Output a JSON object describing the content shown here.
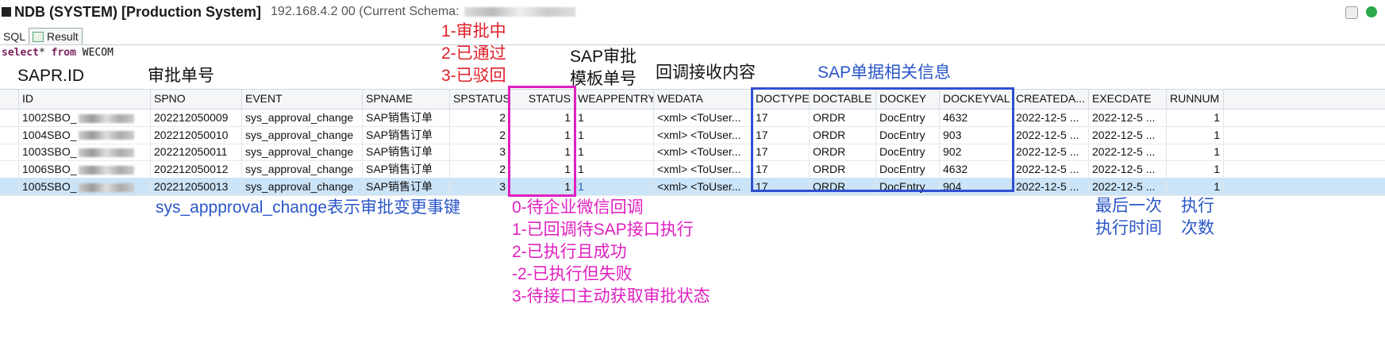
{
  "window": {
    "title": "NDB (SYSTEM) [Production System]",
    "subtitle": "192.168.4.2 00 (Current Schema: "
  },
  "tabs": [
    {
      "label": "SQL"
    },
    {
      "label": "Result"
    }
  ],
  "sql": {
    "kw1": "select",
    "star": "*",
    "kw2": "from",
    "table": "WECOM"
  },
  "annotations": {
    "status_legend": [
      "1-审批中",
      "2-已通过",
      "3-已驳回"
    ],
    "sapr_id": "SAPR.ID",
    "spno": "审批单号",
    "template": [
      "SAP审批",
      "模板单号"
    ],
    "callback": "回调接收内容",
    "sap_info": "SAP单据相关信息",
    "event_note": "sys_appproval_change表示审批变更事键",
    "status_codes": [
      "0-待企业微信回调",
      "1-已回调待SAP接口执行",
      "2-已执行且成功",
      "-2-已执行但失败",
      "3-待接口主动获取审批状态"
    ],
    "last_exec": [
      "最后一次",
      "执行时间"
    ],
    "exec_count": [
      "执行",
      "次数"
    ]
  },
  "grid": {
    "columns": [
      "ID",
      "SPNO",
      "EVENT",
      "SPNAME",
      "SPSTATUS",
      "STATUS",
      "WEAPPENTRY",
      "WEDATA",
      "DOCTYPE",
      "DOCTABLE",
      "DOCKEY",
      "DOCKEYVAL",
      "CREATEDA...",
      "EXECDATE",
      "RUNNUM"
    ],
    "rows": [
      [
        "1002SBO_",
        "202212050009",
        "sys_approval_change",
        "SAP销售订单",
        "2",
        "1",
        "1",
        "<xml> <ToUser...",
        "17",
        "ORDR",
        "DocEntry",
        "4632",
        "2022-12-5 ...",
        "2022-12-5 ...",
        "1"
      ],
      [
        "1004SBO_",
        "202212050010",
        "sys_approval_change",
        "SAP销售订单",
        "2",
        "1",
        "1",
        "<xml> <ToUser...",
        "17",
        "ORDR",
        "DocEntry",
        "903",
        "2022-12-5 ...",
        "2022-12-5 ...",
        "1"
      ],
      [
        "1003SBO_",
        "202212050011",
        "sys_approval_change",
        "SAP销售订单",
        "3",
        "1",
        "1",
        "<xml> <ToUser...",
        "17",
        "ORDR",
        "DocEntry",
        "902",
        "2022-12-5 ...",
        "2022-12-5 ...",
        "1"
      ],
      [
        "1006SBO_",
        "202212050012",
        "sys_approval_change",
        "SAP销售订单",
        "2",
        "1",
        "1",
        "<xml> <ToUser...",
        "17",
        "ORDR",
        "DocEntry",
        "4632",
        "2022-12-5 ...",
        "2022-12-5 ...",
        "1"
      ],
      [
        "1005SBO_",
        "202212050013",
        "sys_approval_change",
        "SAP销售订单",
        "3",
        "1",
        "1",
        "<xml> <ToUser...",
        "17",
        "ORDR",
        "DocEntry",
        "904",
        "2022-12-5 ...",
        "2022-12-5 ...",
        "1"
      ]
    ],
    "selected_row": 4
  },
  "colors": {
    "status_box": "#e020c0",
    "sap_box": "#3050d0",
    "legend_red": "#e0202a",
    "annotation_blue": "#2a56c8",
    "selection": "#cce4f7"
  }
}
